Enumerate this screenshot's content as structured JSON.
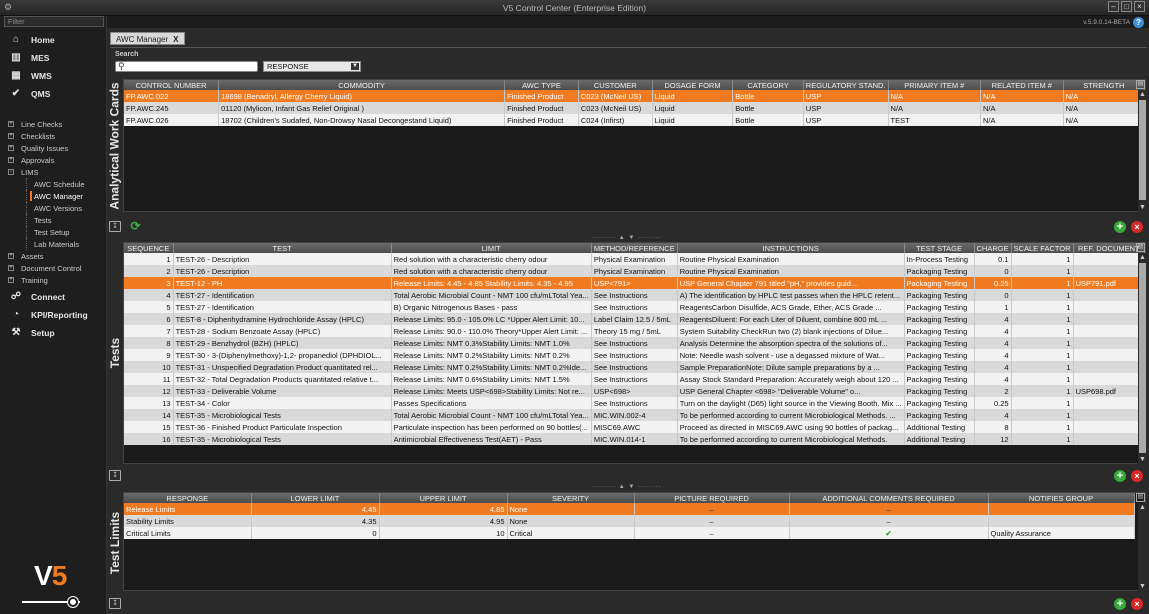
{
  "window": {
    "title": "V5 Control Center (Enterprise Edition)",
    "version": "v.5.9.0.14-BETA"
  },
  "sidebar": {
    "filter_placeholder": "Filter",
    "main_items": [
      {
        "label": "Home",
        "icon": "home-icon"
      },
      {
        "label": "MES",
        "icon": "factory-icon"
      },
      {
        "label": "WMS",
        "icon": "warehouse-icon"
      },
      {
        "label": "QMS",
        "icon": "check-circle-icon"
      }
    ],
    "tree": [
      {
        "label": "Line Checks",
        "expand": "+"
      },
      {
        "label": "Checklists",
        "expand": "+"
      },
      {
        "label": "Quality Issues",
        "expand": "+"
      },
      {
        "label": "Approvals",
        "expand": "+"
      },
      {
        "label": "LIMS",
        "expand": "-"
      }
    ],
    "lims_children": [
      "AWC Schedule",
      "AWC Manager",
      "AWC Versions",
      "Tests",
      "Test Setup",
      "Lab Materials"
    ],
    "tree_after": [
      {
        "label": "Assets",
        "expand": "+"
      },
      {
        "label": "Document Control",
        "expand": "+"
      },
      {
        "label": "Training",
        "expand": "+"
      }
    ],
    "bottom_items": [
      {
        "label": "Connect",
        "icon": "connect-icon"
      },
      {
        "label": "KPI/Reporting",
        "icon": "chart-pie-icon"
      },
      {
        "label": "Setup",
        "icon": "setup-icon"
      }
    ],
    "logo_text": "V5"
  },
  "tab": {
    "label": "AWC Manager",
    "close": "X"
  },
  "search": {
    "label": "Search",
    "value": "",
    "select_value": "RESPONSE"
  },
  "awc": {
    "section_label": "Analytical Work Cards",
    "columns": [
      "CONTROL NUMBER",
      "COMMODITY",
      "AWC TYPE",
      "CUSTOMER",
      "DOSAGE FORM",
      "CATEGORY",
      "REGULATORY STAND.",
      "PRIMARY ITEM #",
      "RELATED ITEM #",
      "STRENGTH"
    ],
    "rows": [
      [
        "FP.AWC.022",
        "18698 (Benadryl, Allergy Cherry Liquid)",
        "Finished Product",
        "C023 (McNeil US)",
        "Liquid",
        "Bottle",
        "USP",
        "N/A",
        "N/A",
        "N/A"
      ],
      [
        "FP.AWC.245",
        "01120 (Mylicon, Infant Gas Relief Original )",
        "Finished Product",
        "C023 (McNeil US)",
        "Liquid",
        "Bottle",
        "USP",
        "N/A",
        "N/A",
        "N/A"
      ],
      [
        "FP.AWC.026",
        "18702 (Children's Sudafed, Non-Drowsy Nasal Decongestand Liquid)",
        "Finished Product",
        "C024 (Infirst)",
        "Liquid",
        "Bottle",
        "USP",
        "TEST",
        "N/A",
        "N/A"
      ]
    ],
    "selected": 0
  },
  "tests": {
    "section_label": "Tests",
    "columns": [
      "SEQUENCE",
      "TEST",
      "LIMIT",
      "METHOD/REFERENCE",
      "INSTRUCTIONS",
      "TEST STAGE",
      "CHARGE",
      "SCALE FACTOR",
      "REF. DOCUMENT"
    ],
    "rows": [
      [
        "1",
        "TEST-26 - Description",
        "Red solution with a characteristic cherry odour",
        "Physical Examination",
        "Routine Physical Examination",
        "In-Process Testing",
        "0.1",
        "1",
        ""
      ],
      [
        "2",
        "TEST-26 - Description",
        "Red solution with a characteristic cherry odour",
        "Physical Examination",
        "Routine Physical Examination",
        "Packaging Testing",
        "0",
        "1",
        ""
      ],
      [
        "3",
        "TEST-12 - PH",
        "Release Limits: 4.45 - 4.85 Stability Limits: 4.35 - 4.95",
        "USP<791>",
        "USP General Chapter 791 titled &quot;pH,&quot; provides guid...",
        "Packaging Testing",
        "0.25",
        "1",
        "USP791.pdf"
      ],
      [
        "4",
        "TEST-27 - Identification",
        "Total Aerobic Microbial Count - NMT 100 cfu/mLTotal Yea...",
        "See Instructions",
        "A) The identification by HPLC test passes when the HPLC retent...",
        "Packaging Testing",
        "0",
        "1",
        ""
      ],
      [
        "5",
        "TEST-27 - Identification",
        "B) Organic Nitrogenous Bases - pass",
        "See Instructions",
        "ReagentsCarbon Disulfide, ACS Grade, Ether, ACS      Grade ...",
        "Packaging Testing",
        "1",
        "1",
        ""
      ],
      [
        "6",
        "TEST-8 - Diphenhydramine Hydrochloride Assay (HPLC)",
        "Release Limits: 95.0 - 105.0% LC *Upper Alert Limit: 10...",
        "Label Claim 12.5 / 5mL",
        "ReagentsDiluent: For each Liter of Diluent, combine      800 mL ...",
        "Packaging Testing",
        "4",
        "1",
        ""
      ],
      [
        "7",
        "TEST-28 - Sodium Benzoate Assay (HPLC)",
        "Release Limits: 90.0 - 110.0% Theory*Upper Alert Limit: ...",
        "Theory 15 mg / 5mL",
        "System Suitability CheckRun two (2)      blank injections of Dilue...",
        "Packaging Testing",
        "4",
        "1",
        ""
      ],
      [
        "8",
        "TEST-29 - Benzhydrol (BZH) (HPLC)",
        "Release Limits: NMT 0.3%Stability Limits: NMT 1.0%",
        "See Instructions",
        "Analysis Determine the absorption spectra of the       solutions of...",
        "Packaging Testing",
        "4",
        "1",
        ""
      ],
      [
        "9",
        "TEST-30 - 3-(Diphenylmethoxy)-1,2- propanediol (DPHDIOL...",
        "Release Limits: NMT 0.2%Stability Limits: NMT 0.2%",
        "See Instructions",
        "Note: Needle wash solvent - use a degassed mixture of      Wat...",
        "Packaging Testing",
        "4",
        "1",
        ""
      ],
      [
        "10",
        "TEST-31 - Unspecified Degradation Product quantitated rel...",
        "Release Limits: NMT 0.2%Stability Limits: NMT 0.2%Ide...",
        "See Instructions",
        "Sample PreparationNote: Dilute sample preparations     by a ...",
        "Packaging Testing",
        "4",
        "1",
        ""
      ],
      [
        "11",
        "TEST-32 - Total Degradation Products quantitated relative t...",
        "Release Limits: NMT 0.6%Stability Limits: NMT 1.5%",
        "See Instructions",
        "Assay Stock Standard Preparation: Accurately weigh about 120 ...",
        "Packaging Testing",
        "4",
        "1",
        ""
      ],
      [
        "12",
        "TEST-33 - Deliverable Volume",
        "Release Limits: Meets USP<698>Stability Limits: Not re...",
        "USP<698>",
        "USP General Chapter <698> &quot;Deliverable Volume&quot; o...",
        "Packaging Testing",
        "2",
        "1",
        "USP698.pdf"
      ],
      [
        "13",
        "TEST-34 - Color",
        "Passes Specifications",
        "See Instructions",
        "Turn on the daylight (D65) light source in the Viewing Booth. Mix ...",
        "Packaging Testing",
        "0.25",
        "1",
        ""
      ],
      [
        "14",
        "TEST-35 - Microbiological Tests",
        "Total Aerobic Microbial Count - NMT 100 cfu/mLTotal Yea...",
        "MIC.WIN.002-4",
        "To be performed according to current Microbiological Methods. ...",
        "Packaging Testing",
        "4",
        "1",
        ""
      ],
      [
        "15",
        "TEST-36 - Finished Product Particulate Inspection",
        "Particulate inspection has been performed on 90 bottles(...",
        "MISC69.AWC",
        "Proceed as directed in MISC69.AWC using 90 bottles of packag...",
        "Additional Testing",
        "8",
        "1",
        ""
      ],
      [
        "16",
        "TEST-35 - Microbiological Tests",
        "Antimicrobial Effectiveness Test(AET) - Pass",
        "MIC.WIN.014-1",
        "To be performed according to current Microbiological Methods.",
        "Additional Testing",
        "12",
        "1",
        ""
      ]
    ],
    "selected": 2
  },
  "limits": {
    "section_label": "Test Limits",
    "columns": [
      "RESPONSE",
      "LOWER LIMIT",
      "UPPER LIMIT",
      "SEVERITY",
      "PICTURE REQUIRED",
      "ADDITIONAL COMMENTS REQUIRED",
      "NOTIFIES GROUP"
    ],
    "rows": [
      {
        "response": "Release Limits",
        "lower": "4.45",
        "upper": "4.85",
        "severity": "None",
        "picture": "dash",
        "comments": "dash",
        "group": ""
      },
      {
        "response": "Stability Limits",
        "lower": "4.35",
        "upper": "4.95",
        "severity": "None",
        "picture": "dash",
        "comments": "dash",
        "group": ""
      },
      {
        "response": "Critical Limits",
        "lower": "0",
        "upper": "10",
        "severity": "Critical",
        "picture": "dash",
        "comments": "check",
        "group": "Quality Assurance"
      }
    ],
    "selected": 0
  },
  "colors": {
    "accent": "#f07a1f",
    "add": "#37a83a",
    "delete": "#d62a2a"
  }
}
